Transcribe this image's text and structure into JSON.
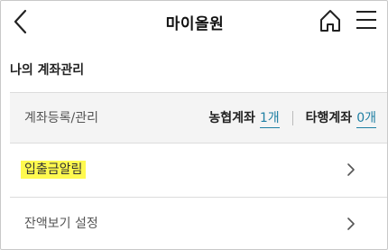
{
  "header": {
    "title": "마이올원",
    "back_icon": "chevron-left-icon",
    "home_icon": "home-icon",
    "menu_icon": "hamburger-menu-icon"
  },
  "section": {
    "title": "나의 계좌관리"
  },
  "account_row": {
    "label": "계좌등록/관리",
    "nh_label": "농협계좌",
    "nh_count": "1개",
    "other_label": "타행계좌",
    "other_count": "0개"
  },
  "rows": [
    {
      "label": "입출금알림",
      "highlighted": true
    },
    {
      "label": "잔액보기 설정",
      "highlighted": false
    }
  ],
  "colors": {
    "link": "#1f7fa3",
    "highlight": "#fff94f"
  }
}
